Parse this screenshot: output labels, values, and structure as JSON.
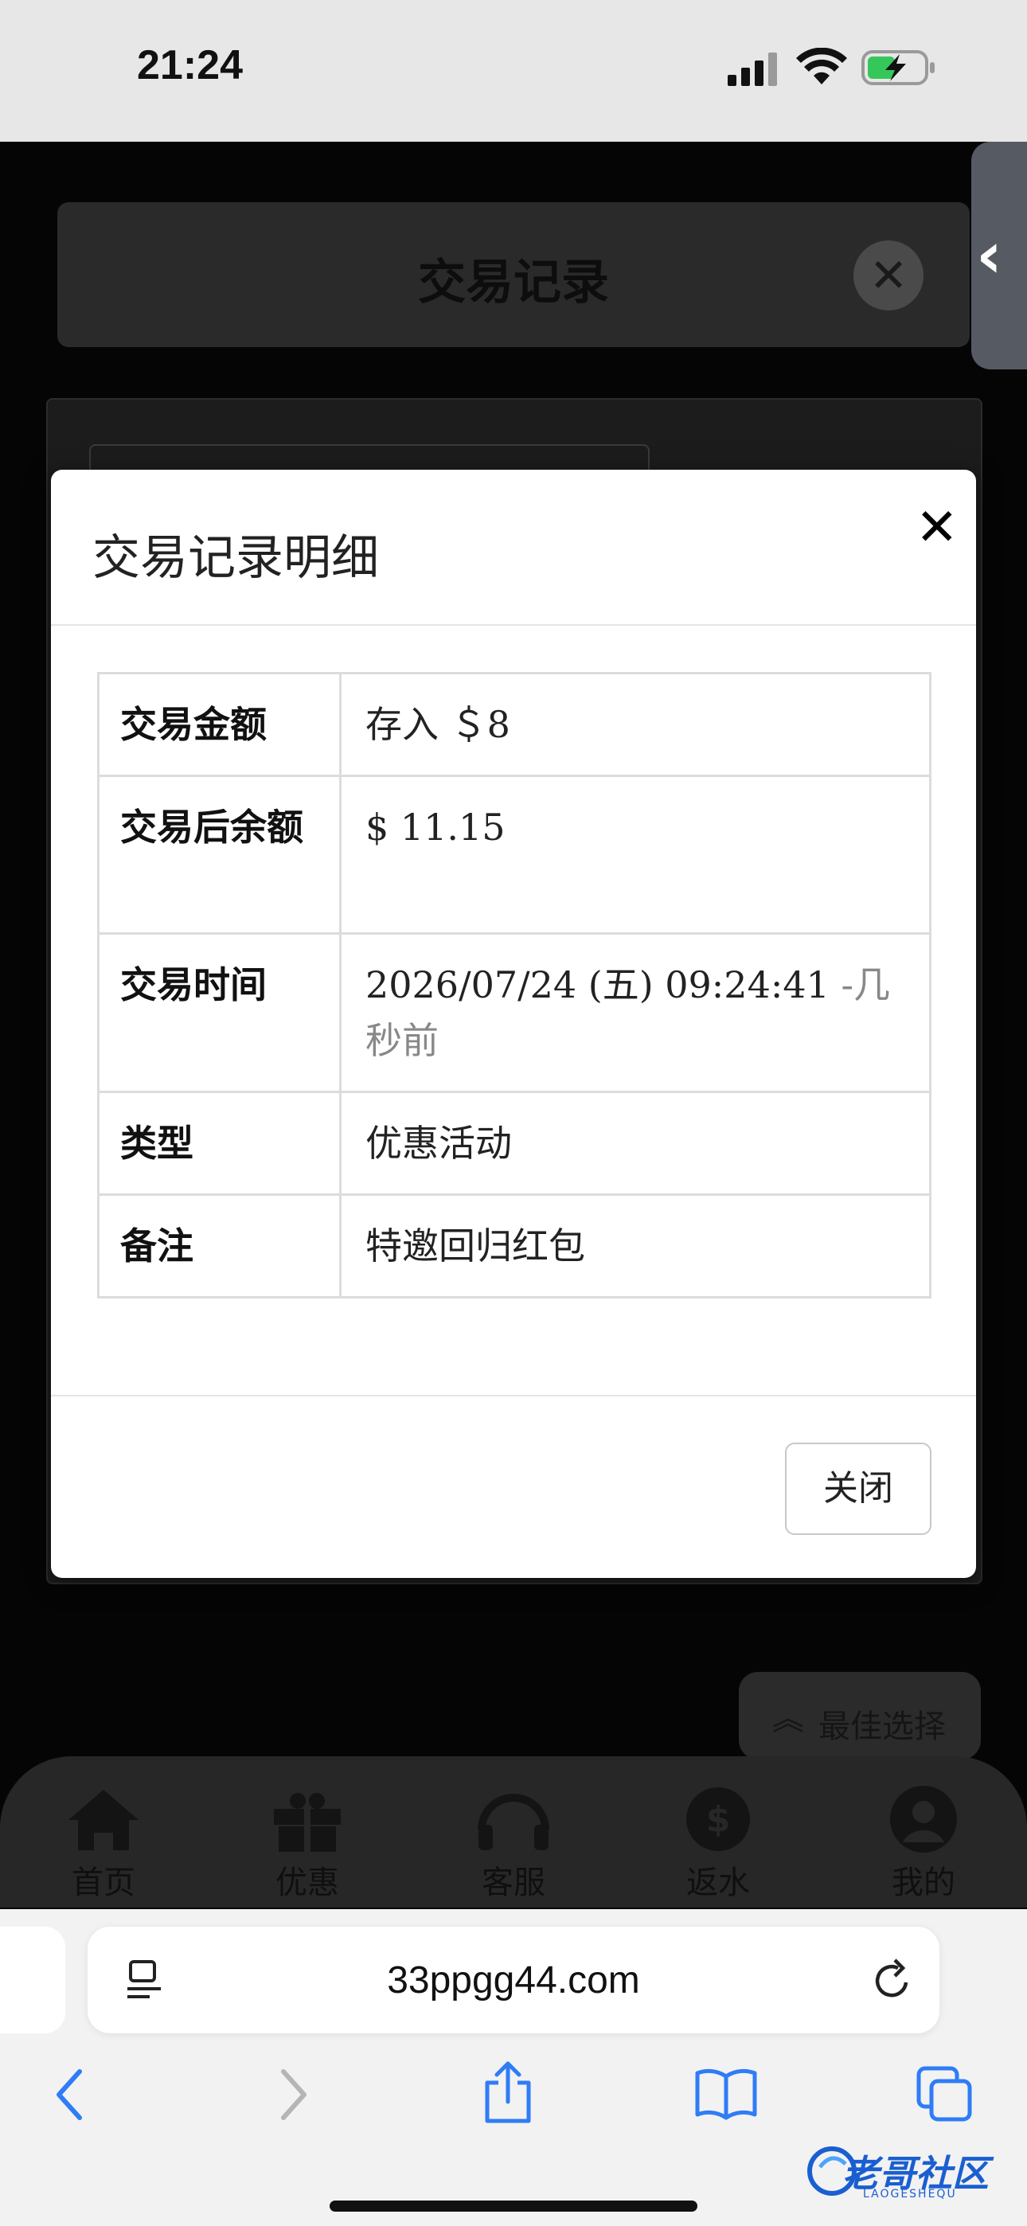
{
  "status_bar": {
    "time": "21:24"
  },
  "background_page": {
    "header_title": "交易记录",
    "best_choice_label": "最佳选择",
    "bottom_nav": [
      {
        "label": "首页",
        "icon": "home-icon"
      },
      {
        "label": "优惠",
        "icon": "gift-icon"
      },
      {
        "label": "客服",
        "icon": "headset-icon"
      },
      {
        "label": "返水",
        "icon": "dollar-badge-icon"
      },
      {
        "label": "我的",
        "icon": "user-icon"
      }
    ]
  },
  "modal": {
    "title": "交易记录明细",
    "rows": [
      {
        "key": "交易金额",
        "value": "存入 ＄8"
      },
      {
        "key": "交易后余额",
        "value": "$ 11.15"
      },
      {
        "key": "交易时间",
        "value": "2026/07/24 (五) 09:24:41",
        "suffix": "-几秒前"
      },
      {
        "key": "类型",
        "value": "优惠活动"
      },
      {
        "key": "备注",
        "value": "特邀回归红包"
      }
    ],
    "close_label": "关闭"
  },
  "browser": {
    "url": "33ppgg44.com"
  },
  "watermark": {
    "text": "老哥社区",
    "sub": "LAOGESHEQU"
  },
  "colors": {
    "amount_green": "#3a7a3a",
    "safari_blue": "#2f7cf6"
  }
}
